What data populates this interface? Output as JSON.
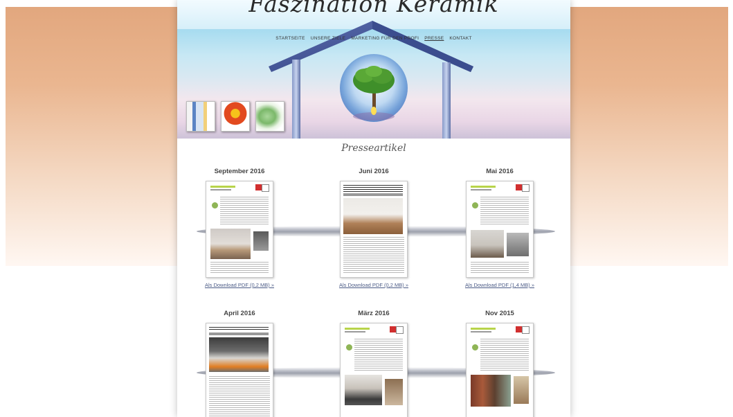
{
  "site": {
    "title": "Faszination Keramik"
  },
  "nav": {
    "items": [
      {
        "label": "STARTSEITE",
        "active": false
      },
      {
        "label": "UNSERE ZIELE",
        "active": false
      },
      {
        "label": "MARKETING FÜR DEN PROFI",
        "active": false
      },
      {
        "label": "PRESSE",
        "active": true
      },
      {
        "label": "KONTAKT",
        "active": false
      }
    ]
  },
  "header_thumbs": [
    "blue-stripes-thumbnail",
    "sun-logo-thumbnail",
    "leaf-thumbnail"
  ],
  "section": {
    "title": "Presseartikel"
  },
  "articles": [
    {
      "month": "September 2016",
      "link": "Als Download PDF (0,2 MB) »",
      "style": "green"
    },
    {
      "month": "Juni 2016",
      "link": "Als Download PDF (0,2 MB) »",
      "style": "headline"
    },
    {
      "month": "Mai 2016",
      "link": "Als Download PDF (1,4 MB) »",
      "style": "green"
    },
    {
      "month": "April 2016",
      "link": "",
      "style": "headline"
    },
    {
      "month": "März 2016",
      "link": "",
      "style": "green"
    },
    {
      "month": "Nov 2015",
      "link": "",
      "style": "green"
    }
  ],
  "colors": {
    "background_orange": "#e2a77e",
    "link": "#4b5b86",
    "accent_green": "#b8d44a",
    "logo_red": "#d12f2f"
  }
}
